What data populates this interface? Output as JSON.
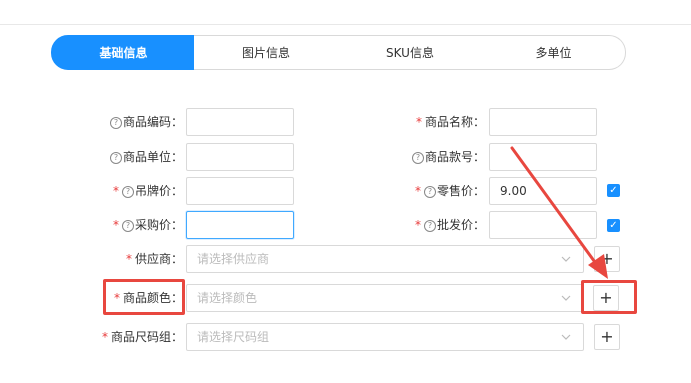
{
  "tabs": [
    {
      "label": "基础信息",
      "active": true
    },
    {
      "label": "图片信息",
      "active": false
    },
    {
      "label": "SKU信息",
      "active": false
    },
    {
      "label": "多单位",
      "active": false
    }
  ],
  "form": {
    "product_code_label": "商品编码：",
    "product_name_label": "商品名称：",
    "product_unit_label": "商品单位：",
    "product_model_label": "商品款号：",
    "tag_price_label": "吊牌价：",
    "retail_price_label": "零售价：",
    "retail_price_value": "9.00",
    "purchase_price_label": "采购价：",
    "wholesale_price_label": "批发价：",
    "supplier_label": "供应商：",
    "supplier_placeholder": "请选择供应商",
    "color_label": "商品颜色：",
    "color_placeholder": "请选择颜色",
    "size_group_label": "商品尺码组：",
    "size_group_placeholder": "请选择尺码组",
    "required_mark": "*",
    "help_mark": "?",
    "check_mark": "✓",
    "add_label": "+"
  },
  "colors": {
    "accent": "#1890ff",
    "required": "#e83a3a",
    "highlight": "#e8473f"
  },
  "icons": [
    "help-icon",
    "chevron-down-icon",
    "check-icon",
    "plus-icon",
    "annotation-arrow"
  ]
}
